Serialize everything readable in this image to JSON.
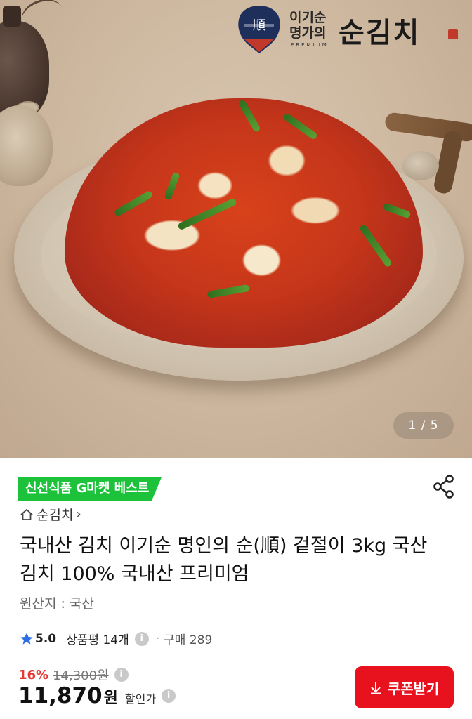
{
  "hero": {
    "pagination": "1 / 5",
    "logo": {
      "emblem_char": "順",
      "line1": "이기순",
      "line2": "명가의",
      "premium": "PREMIUM",
      "brand_name": "순김치"
    }
  },
  "product": {
    "badge": "신선식품 G마켓 베스트",
    "brand": "순김치",
    "title": "국내산 김치 이기순 명인의 순(順) 겉절이 3kg 국산 김치 100% 국내산 프리미엄",
    "origin": "원산지 : 국산",
    "rating": "5.0",
    "review_link": "상품평 14개",
    "purchase_count": "구매 289"
  },
  "price": {
    "discount_rate": "16%",
    "original_price": "14,300원",
    "sale_price": "11,870",
    "currency": "원",
    "sale_label": "할인가"
  },
  "coupon_button": {
    "label": "쿠폰받기"
  },
  "colors": {
    "best_badge": "#1bc23a",
    "discount": "#e53935",
    "coupon_button": "#e8121e",
    "star": "#2f6fe4"
  }
}
